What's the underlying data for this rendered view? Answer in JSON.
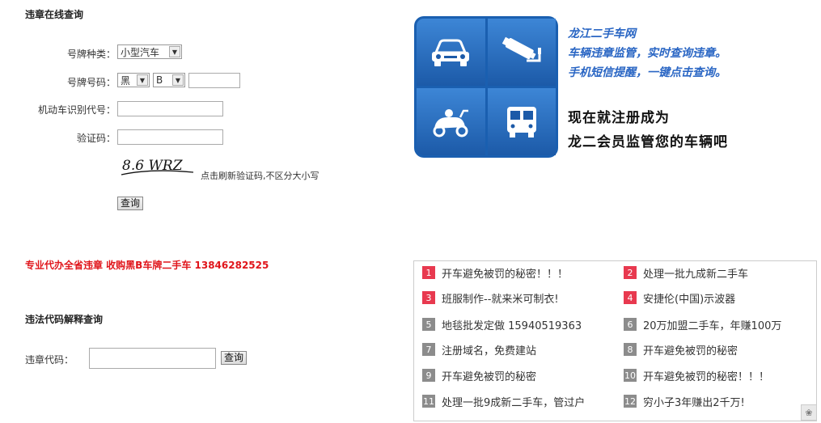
{
  "query": {
    "title": "违章在线查询",
    "plate_type_label": "号牌种类：",
    "plate_type_value": "小型汽车",
    "plate_number_label": "号牌号码：",
    "plate_prefix_value": "黑",
    "plate_letter_value": "B",
    "vin_label": "机动车识别代号：",
    "captcha_label": "验证码：",
    "captcha_image_text": "8.6 WRZ",
    "captcha_hint": "点击刷新验证码,不区分大小写",
    "submit_label": "查询"
  },
  "promo": {
    "text": "专业代办全省违章 收购黑B车牌二手车 13846282525"
  },
  "code_lookup": {
    "title": "违法代码解释查询",
    "code_label": "违章代码：",
    "submit_label": "查询"
  },
  "banner": {
    "site_name": "龙江二手车网",
    "line1": "车辆违章监管，实时查询违章。",
    "line2": "手机短信提醒，一键点击查询。",
    "cta_line1": "现在就注册成为",
    "cta_line2": "龙二会员监管您的车辆吧",
    "icons": [
      "car-icon",
      "camera-icon",
      "scooter-icon",
      "bus-icon"
    ],
    "bg_color": "#1a5fb0"
  },
  "links": [
    {
      "num": "1",
      "text": "开车避免被罚的秘密！！！",
      "hot": true
    },
    {
      "num": "2",
      "text": "处理一批九成新二手车",
      "hot": true
    },
    {
      "num": "3",
      "text": "班服制作--就来米可制衣!",
      "hot": true
    },
    {
      "num": "4",
      "text": "安捷伦(中国)示波器",
      "hot": true
    },
    {
      "num": "5",
      "text": "地毯批发定做 15940519363",
      "hot": false
    },
    {
      "num": "6",
      "text": "20万加盟二手车，年赚100万",
      "hot": false
    },
    {
      "num": "7",
      "text": "注册域名，免费建站",
      "hot": false
    },
    {
      "num": "8",
      "text": "开车避免被罚的秘密",
      "hot": false
    },
    {
      "num": "9",
      "text": "开车避免被罚的秘密",
      "hot": false
    },
    {
      "num": "10",
      "text": "开车避免被罚的秘密！！！",
      "hot": false
    },
    {
      "num": "11",
      "text": "处理一批9成新二手车，管过户",
      "hot": false
    },
    {
      "num": "12",
      "text": "穷小子3年赚出2千万!",
      "hot": false
    }
  ],
  "colors": {
    "promo": "#e0151b",
    "badge_hot": "#e8394f",
    "badge_cold": "#8c8c8c",
    "tagline": "#2a66c4"
  }
}
